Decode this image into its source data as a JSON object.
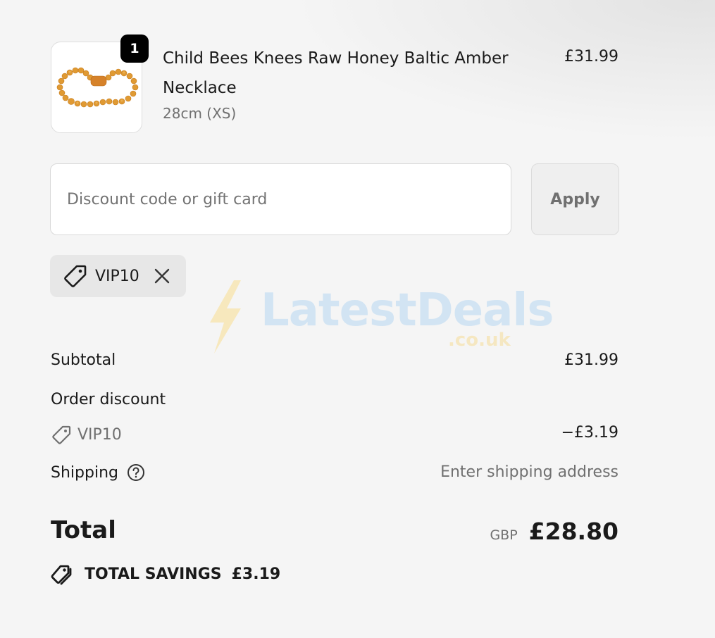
{
  "product": {
    "title": "Child Bees Knees Raw Honey Baltic Amber Necklace",
    "variant": "28cm (XS)",
    "price": "£31.99",
    "quantity": "1",
    "image_icon": "amber-necklace-image"
  },
  "discount": {
    "placeholder": "Discount code or gift card",
    "value": "",
    "apply_label": "Apply",
    "applied_code": "VIP10"
  },
  "watermark": {
    "name": "LatestDeals",
    "domain": ".co.uk"
  },
  "summary": {
    "subtotal_label": "Subtotal",
    "subtotal_value": "£31.99",
    "order_discount_label": "Order discount",
    "discount_code": "VIP10",
    "discount_value": "−£3.19",
    "shipping_label": "Shipping",
    "shipping_value": "Enter shipping address",
    "total_label": "Total",
    "currency": "GBP",
    "total_value": "£28.80",
    "savings_label": "TOTAL SAVINGS",
    "savings_value": "£3.19"
  },
  "colors": {
    "background": "#f5f5f5",
    "text": "#1a1a1a",
    "muted": "#707070",
    "badge": "#000000",
    "amber": "#e0962e"
  }
}
